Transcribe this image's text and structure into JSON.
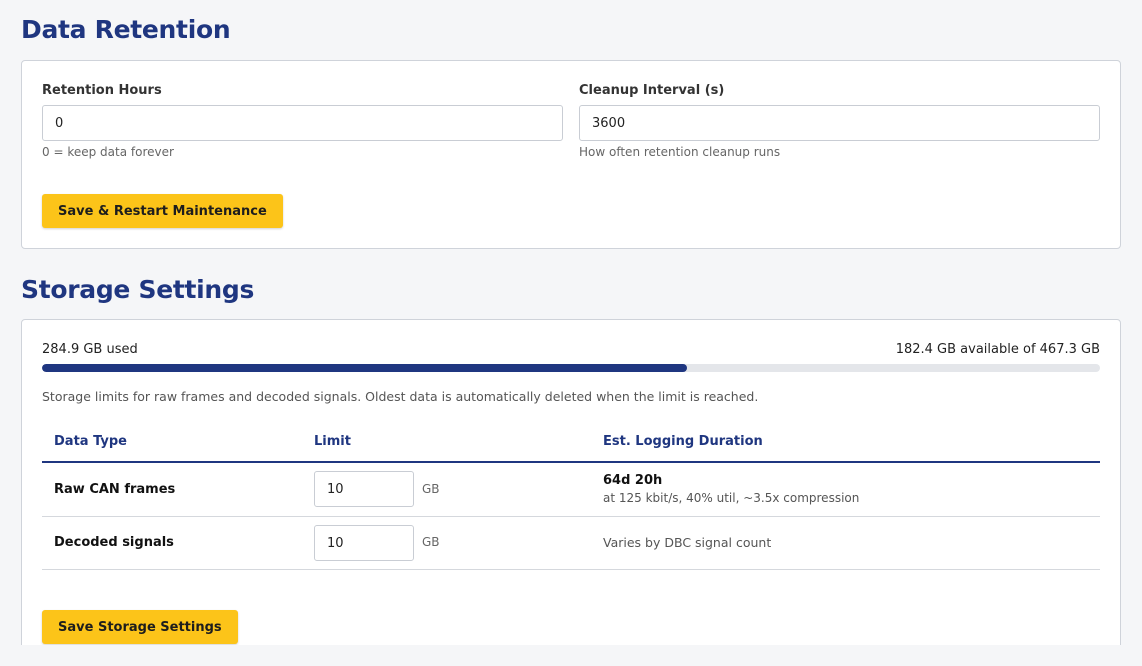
{
  "retention": {
    "title": "Data Retention",
    "hours_label": "Retention Hours",
    "hours_value": "0",
    "hours_hint": "0 = keep data forever",
    "interval_label": "Cleanup Interval (s)",
    "interval_value": "3600",
    "interval_hint": "How often retention cleanup runs",
    "save_label": "Save & Restart Maintenance"
  },
  "storage": {
    "title": "Storage Settings",
    "used_text": "284.9 GB used",
    "available_text": "182.4 GB available of 467.3 GB",
    "used_fraction": 0.61,
    "description": "Storage limits for raw frames and decoded signals. Oldest data is automatically deleted when the limit is reached.",
    "columns": [
      "Data Type",
      "Limit",
      "Est. Logging Duration"
    ],
    "rows": [
      {
        "type": "Raw CAN frames",
        "limit": "10",
        "unit": "GB",
        "duration": "64d 20h",
        "duration_note": "at 125 kbit/s, 40% util, ~3.5x compression"
      },
      {
        "type": "Decoded signals",
        "limit": "10",
        "unit": "GB",
        "duration": "",
        "duration_note": "Varies by DBC signal count"
      }
    ],
    "save_label": "Save Storage Settings"
  },
  "colors": {
    "accent": "#1f3680",
    "button": "#fcc419",
    "track": "#e4e6ea"
  }
}
